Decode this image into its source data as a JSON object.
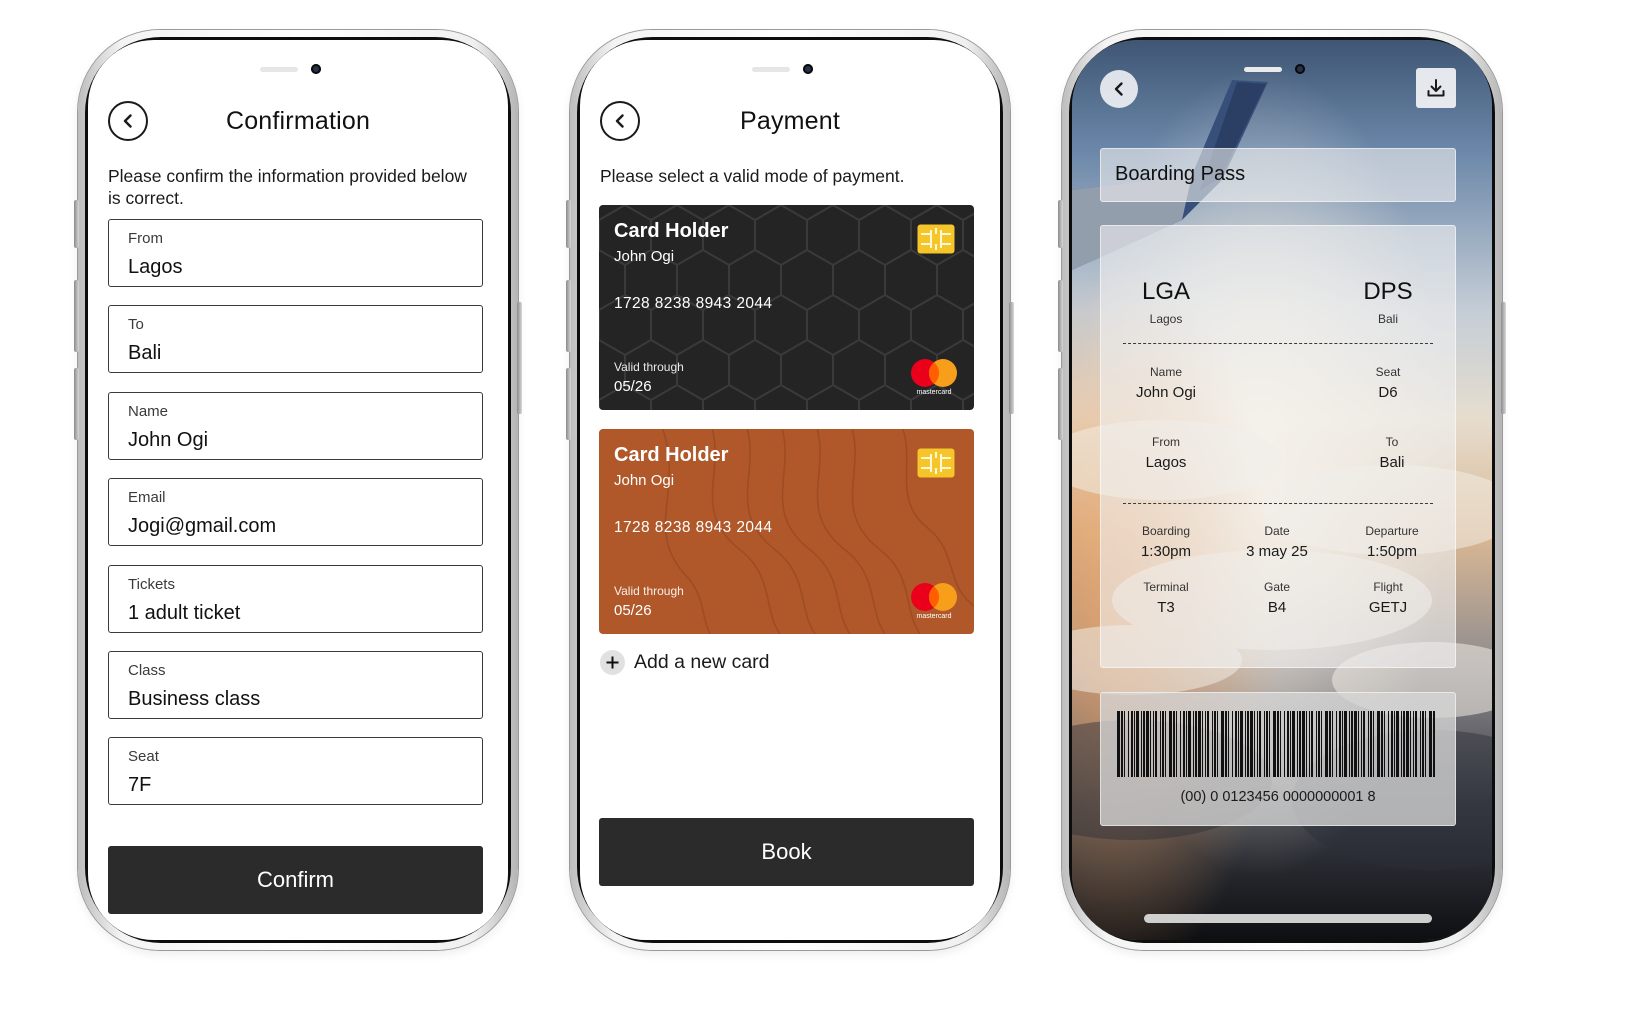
{
  "confirmation": {
    "title": "Confirmation",
    "intro": "Please confirm the information provided below is correct.",
    "fields": [
      {
        "label": "From",
        "value": "Lagos"
      },
      {
        "label": "To",
        "value": "Bali"
      },
      {
        "label": "Name",
        "value": "John Ogi"
      },
      {
        "label": "Email",
        "value": "Jogi@gmail.com"
      },
      {
        "label": "Tickets",
        "value": "1 adult ticket"
      },
      {
        "label": "Class",
        "value": "Business class"
      },
      {
        "label": "Seat",
        "value": "7F"
      }
    ],
    "confirm_label": "Confirm"
  },
  "payment": {
    "title": "Payment",
    "intro": "Please select a valid mode of payment.",
    "cards": [
      {
        "holder_title": "Card Holder",
        "holder_name": "John Ogi",
        "number": "1728 8238 8943 2044",
        "valid_label": "Valid through",
        "valid_date": "05/26",
        "brand": "mastercard",
        "color": "#242424"
      },
      {
        "holder_title": "Card Holder",
        "holder_name": "John Ogi",
        "number": "1728 8238 8943 2044",
        "valid_label": "Valid through",
        "valid_date": "05/26",
        "brand": "mastercard",
        "color": "#b0582a"
      }
    ],
    "add_card_label": "Add a new card",
    "book_label": "Book"
  },
  "boarding_pass": {
    "title": "Boarding Pass",
    "origin": {
      "code": "LGA",
      "city": "Lagos"
    },
    "destination": {
      "code": "DPS",
      "city": "Bali"
    },
    "name": {
      "label": "Name",
      "value": "John Ogi"
    },
    "seat": {
      "label": "Seat",
      "value": "D6"
    },
    "from": {
      "label": "From",
      "value": "Lagos"
    },
    "to": {
      "label": "To",
      "value": "Bali"
    },
    "boarding": {
      "label": "Boarding",
      "value": "1:30pm"
    },
    "date": {
      "label": "Date",
      "value": "3 may 25"
    },
    "departure": {
      "label": "Departure",
      "value": "1:50pm"
    },
    "terminal": {
      "label": "Terminal",
      "value": "T3"
    },
    "gate": {
      "label": "Gate",
      "value": "B4"
    },
    "flight": {
      "label": "Flight",
      "value": "GETJ"
    },
    "barcode_number": "(00) 0 0123456 0000000001 8"
  },
  "icons": {
    "back": "chevron-left-icon",
    "download": "download-icon",
    "add": "plus-icon",
    "chip": "card-chip-icon",
    "brand": "mastercard-logo"
  },
  "colors": {
    "primary_button": "#2b2b2b",
    "dark_card": "#242424",
    "copper_card": "#b0582a",
    "chip": "#f5c52a",
    "mastercard_red": "#eb001b",
    "mastercard_orange": "#f79e1b"
  }
}
